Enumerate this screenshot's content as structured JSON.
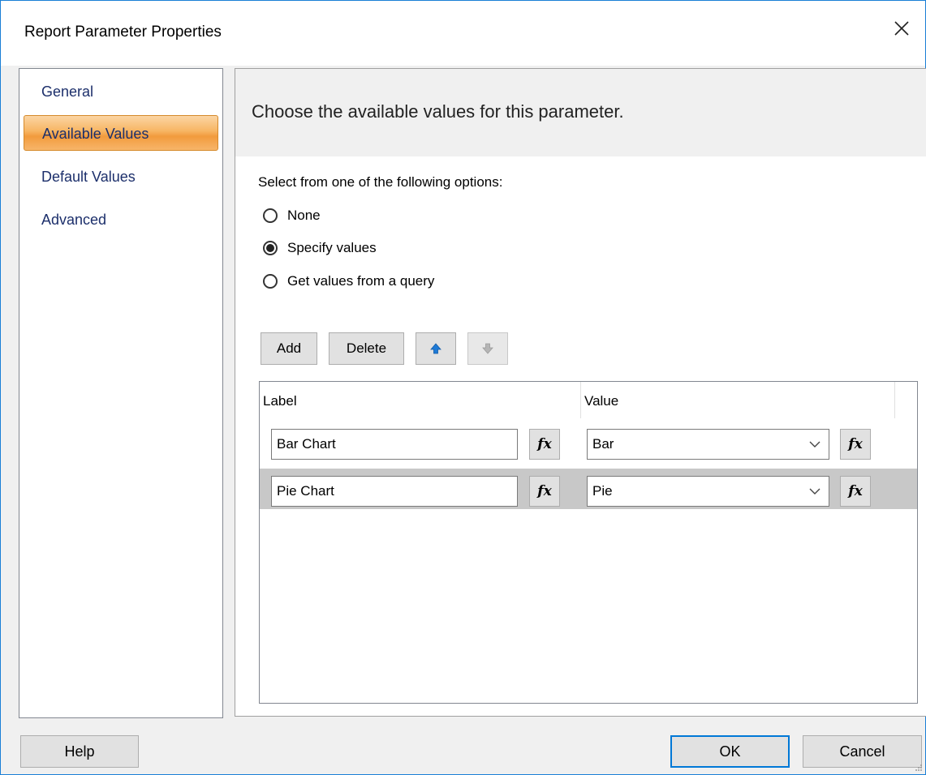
{
  "window": {
    "title": "Report Parameter Properties"
  },
  "nav": {
    "items": [
      {
        "label": "General",
        "active": false
      },
      {
        "label": "Available Values",
        "active": true
      },
      {
        "label": "Default Values",
        "active": false
      },
      {
        "label": "Advanced",
        "active": false
      }
    ]
  },
  "content": {
    "header": "Choose the available values for this parameter.",
    "prompt": "Select from one of the following options:",
    "options": [
      {
        "label": "None",
        "selected": false
      },
      {
        "label": "Specify values",
        "selected": true
      },
      {
        "label": "Get values from a query",
        "selected": false
      }
    ],
    "toolbar": {
      "add_label": "Add",
      "delete_label": "Delete"
    },
    "grid": {
      "columns": [
        "Label",
        "Value"
      ],
      "rows": [
        {
          "label": "Bar Chart",
          "value": "Bar",
          "fx": "fx"
        },
        {
          "label": "Pie Chart",
          "value": "Pie",
          "fx": "fx"
        }
      ]
    }
  },
  "footer": {
    "help_label": "Help",
    "ok_label": "OK",
    "cancel_label": "Cancel"
  },
  "colors": {
    "accent": "#0078d7",
    "nav_active": "#f7b562",
    "nav_text": "#1c2f6b"
  }
}
